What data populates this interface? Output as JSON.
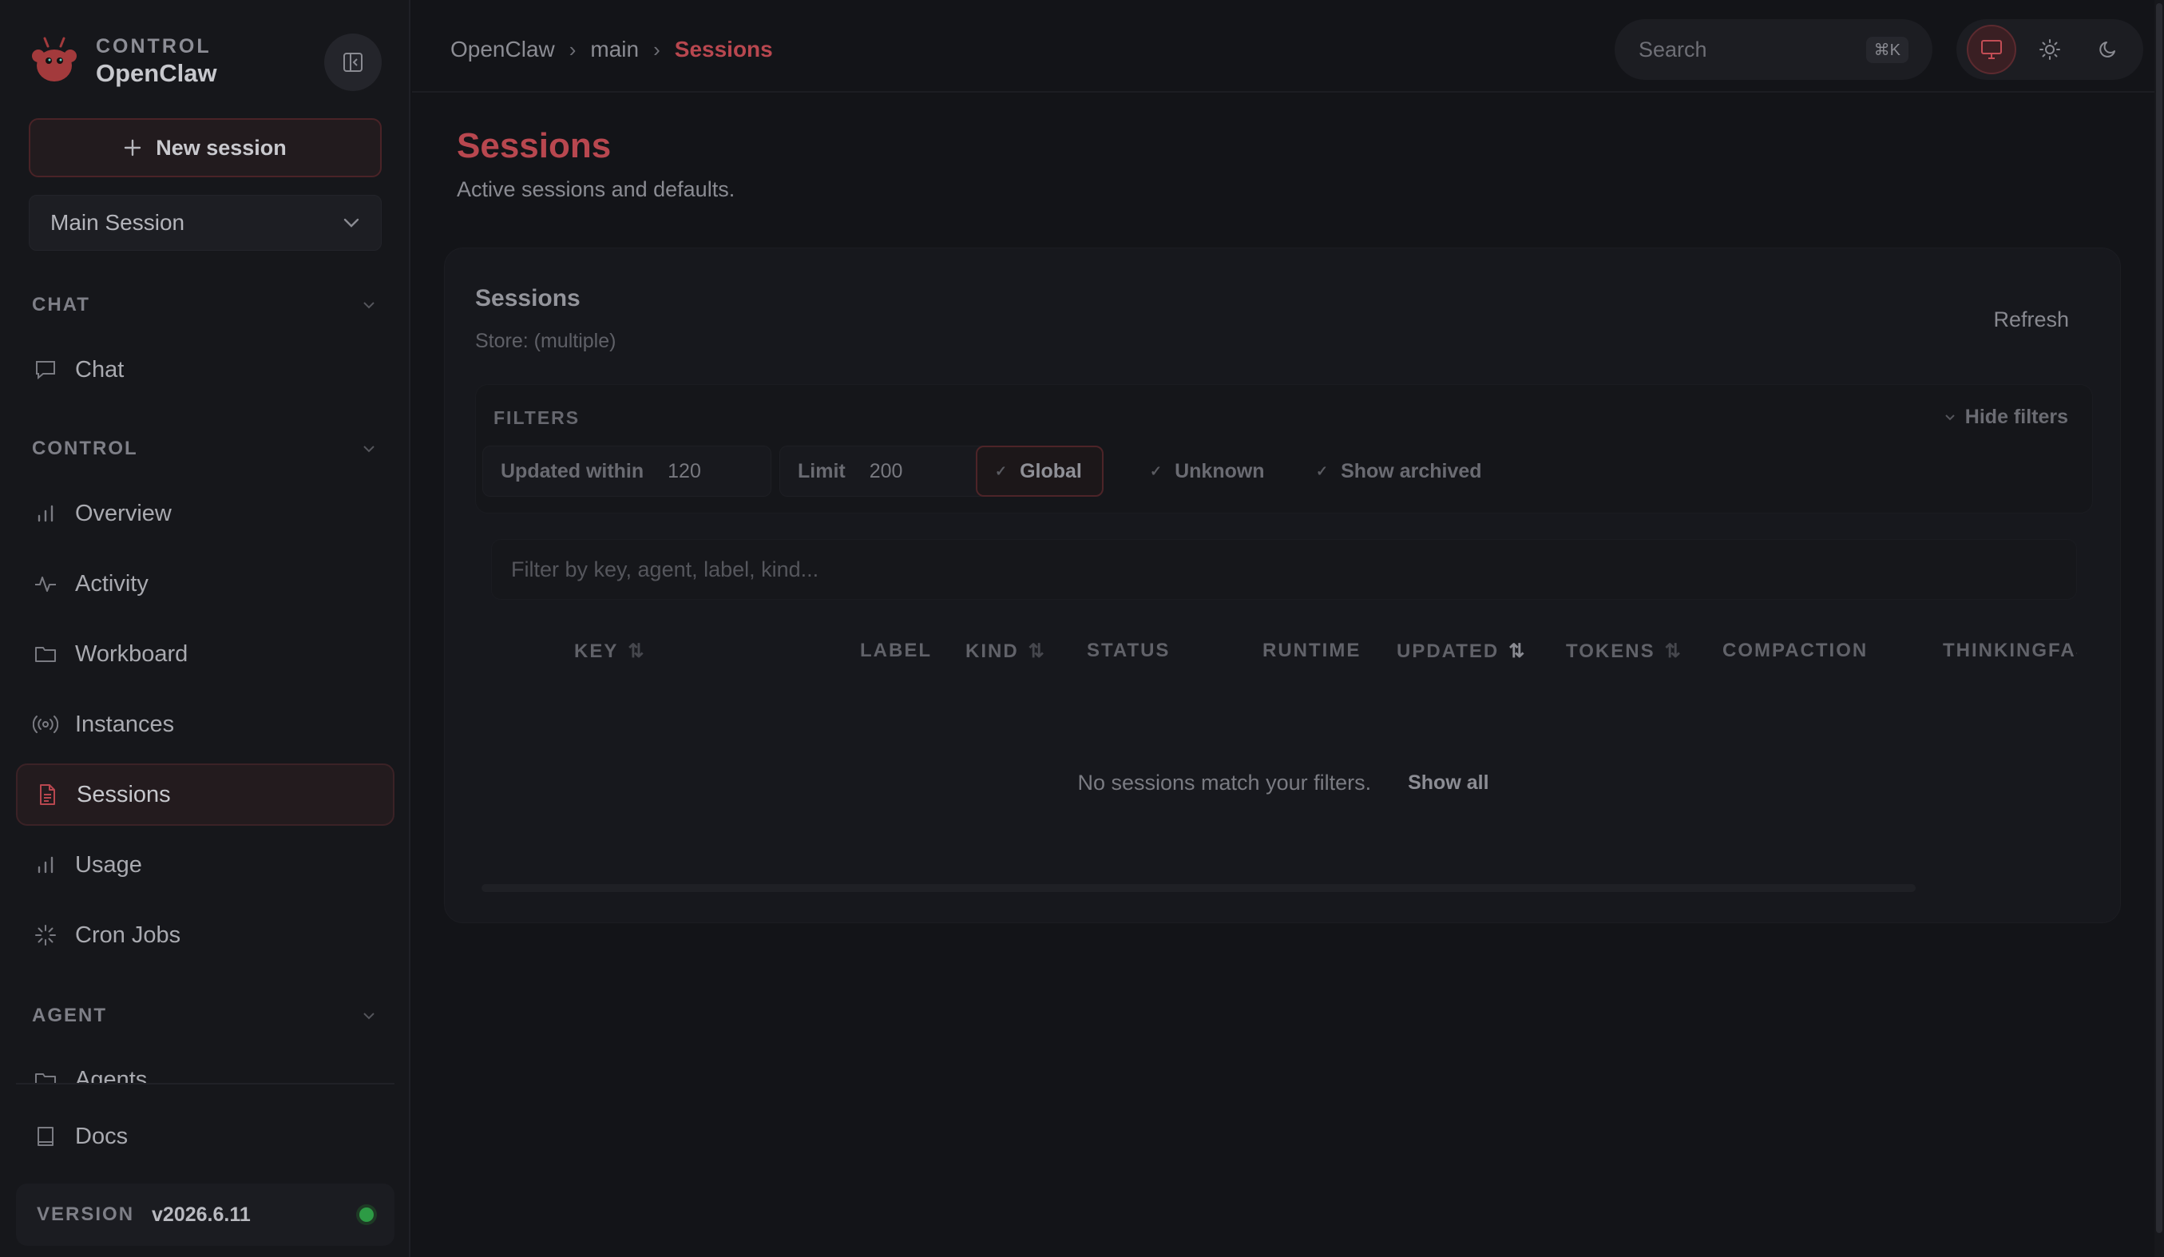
{
  "brand": {
    "small": "CONTROL",
    "name": "OpenClaw"
  },
  "sidebar": {
    "new_session": "New session",
    "session_select": "Main Session",
    "sections": {
      "chat": "CHAT",
      "control": "CONTROL",
      "agent": "AGENT"
    },
    "items": {
      "chat": "Chat",
      "overview": "Overview",
      "activity": "Activity",
      "workboard": "Workboard",
      "instances": "Instances",
      "sessions": "Sessions",
      "usage": "Usage",
      "cron_jobs": "Cron Jobs",
      "agents": "Agents",
      "docs": "Docs"
    },
    "version_label": "VERSION",
    "version": "v2026.6.11"
  },
  "topbar": {
    "breadcrumb": [
      "OpenClaw",
      "main",
      "Sessions"
    ],
    "breadcrumb_sep": "›",
    "search_placeholder": "Search",
    "search_shortcut": "⌘K"
  },
  "page": {
    "title": "Sessions",
    "subtitle": "Active sessions and defaults."
  },
  "card": {
    "title": "Sessions",
    "store": "Store: (multiple)",
    "refresh": "Refresh",
    "filters_label": "FILTERS",
    "hide_filters": "Hide filters",
    "updated_within_label": "Updated within",
    "updated_within_value": "120",
    "limit_label": "Limit",
    "limit_value": "200",
    "global_label": "Global",
    "unknown_label": "Unknown",
    "show_archived_label": "Show archived",
    "filter_placeholder": "Filter by key, agent, label, kind...",
    "columns": [
      "KEY",
      "LABEL",
      "KIND",
      "STATUS",
      "RUNTIME",
      "UPDATED",
      "TOKENS",
      "COMPACTION",
      "THINKING",
      "FAST"
    ],
    "empty_text": "No sessions match your filters.",
    "show_all": "Show all"
  },
  "colors": {
    "accent": "#b8474f",
    "background": "#131418",
    "sidebar": "#16171b",
    "online": "#2d9b45"
  },
  "icons": {
    "logo": "lobster-logo-icon",
    "collapse": "sidebar-collapse-icon",
    "plus": "plus-icon",
    "chevron": "chevron-down-icon",
    "monitor": "monitor-icon",
    "sun": "sun-icon",
    "moon": "moon-icon"
  }
}
